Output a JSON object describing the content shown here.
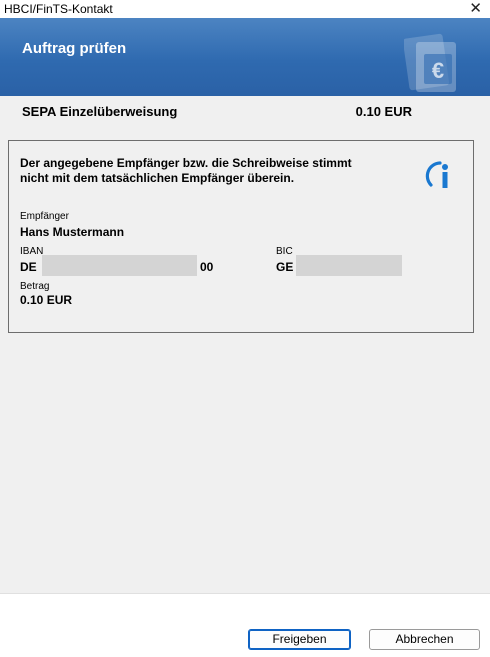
{
  "window": {
    "title": "HBCI/FinTS-Kontakt",
    "close_glyph": "✕"
  },
  "header": {
    "title": "Auftrag prüfen",
    "decor_icon": "euro-document-icon"
  },
  "summary": {
    "type": "SEPA Einzelüberweisung",
    "amount": "0.10 EUR"
  },
  "notice": {
    "line1": "Der angegebene Empfänger bzw. die Schreibweise stimmt",
    "line2": "nicht mit dem tatsächlichen Empfänger überein.",
    "icon": "info-icon"
  },
  "details": {
    "recipient_label": "Empfänger",
    "recipient_value": "Hans Mustermann",
    "iban_label": "IBAN",
    "iban_prefix": "DE",
    "iban_suffix": "00",
    "bic_label": "BIC",
    "bic_prefix": "GE",
    "amount_label": "Betrag",
    "amount_value": "0.10 EUR"
  },
  "buttons": {
    "release": "Freigeben",
    "cancel": "Abbrechen"
  },
  "colors": {
    "header_top": "#4c84c2",
    "header_bottom": "#2a61a6",
    "accent": "#0f63c4",
    "info_blue": "#1a78d0"
  }
}
